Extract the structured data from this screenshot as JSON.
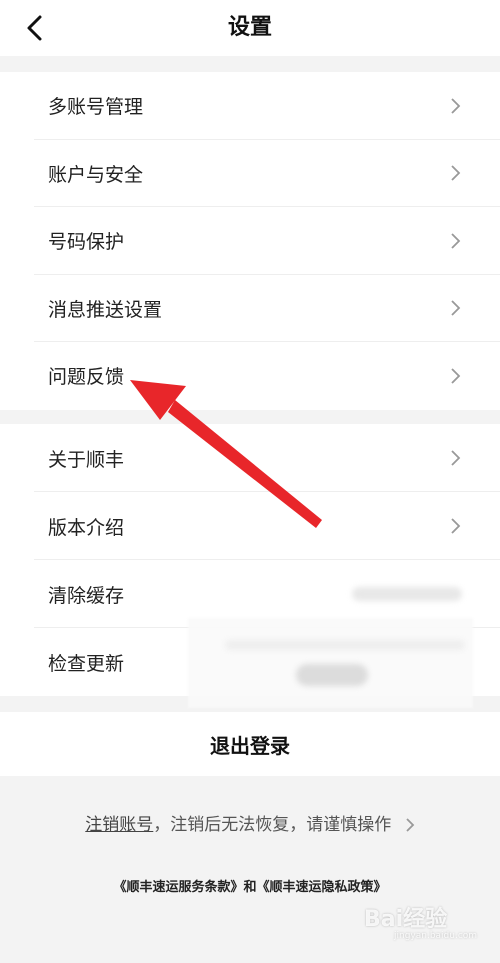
{
  "nav": {
    "title": "设置"
  },
  "group1": [
    {
      "label": "多账号管理"
    },
    {
      "label": "账户与安全"
    },
    {
      "label": "号码保护"
    },
    {
      "label": "消息推送设置"
    },
    {
      "label": "问题反馈"
    }
  ],
  "group2": [
    {
      "label": "关于顺丰"
    },
    {
      "label": "版本介绍"
    },
    {
      "label": "清除缓存"
    },
    {
      "label": "检查更新"
    }
  ],
  "logout": {
    "label": "退出登录"
  },
  "cancel_account": {
    "link": "注销账号",
    "notice": "，注销后无法恢复，请谨慎操作"
  },
  "terms": {
    "service": "《顺丰速运服务条款》",
    "and": "和",
    "privacy": "《顺丰速运隐私政策》"
  },
  "watermark": {
    "brand": "Bai经验",
    "sub": "jingyan.baidu.com"
  },
  "colors": {
    "annotation_arrow": "#e8262a",
    "background": "#f3f3f3"
  }
}
